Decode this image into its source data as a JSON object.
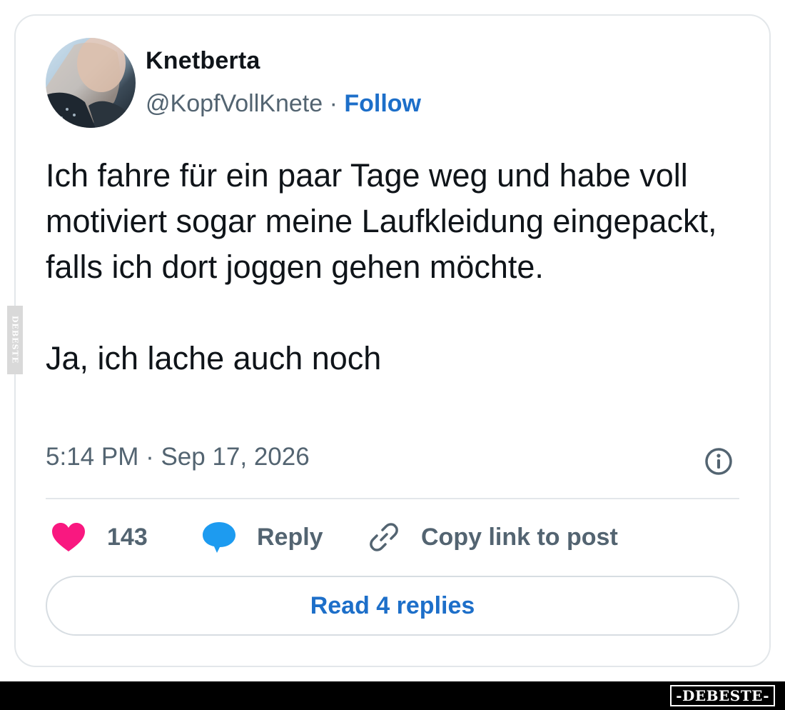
{
  "author": {
    "name": "Knetberta",
    "handle": "@KopfVollKnete",
    "separator": " · ",
    "follow_label": "Follow"
  },
  "tweet": {
    "paragraphs": [
      "Ich fahre für ein paar Tage weg und habe voll motiviert sogar meine Laufkleidung eingepackt, falls ich dort joggen gehen möchte.",
      "Ja, ich lache auch noch"
    ],
    "timestamp": "5:14 PM · Sep 17, 2026"
  },
  "actions": {
    "like_count": "143",
    "reply_label": "Reply",
    "copy_link_label": "Copy link to post"
  },
  "read_replies_label": "Read 4 replies",
  "watermarks": {
    "side": "DEBESTE",
    "footer": "-DEBESTE-"
  },
  "colors": {
    "accent": "#1d6fc9",
    "like": "#f91880",
    "reply_bubble": "#1d9bf0",
    "secondary_text": "#536471"
  },
  "icons": [
    "heart-icon",
    "speech-bubble-icon",
    "link-icon",
    "info-icon"
  ]
}
